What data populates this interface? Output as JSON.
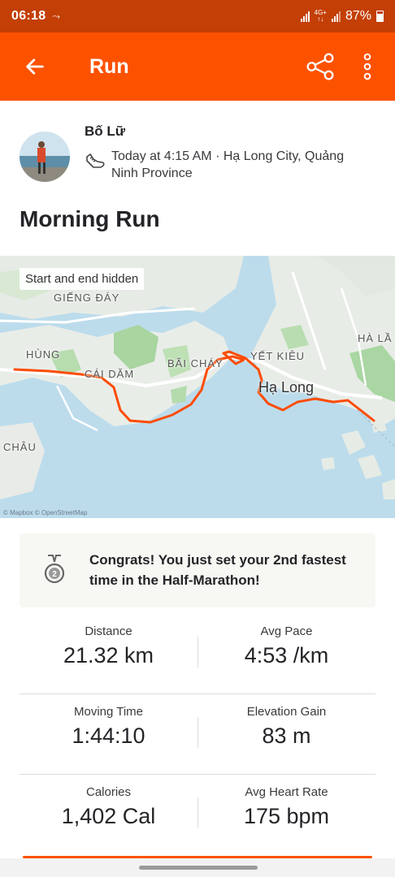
{
  "status_bar": {
    "time": "06:18",
    "notification_icon": "missed-call-icon",
    "battery": "87%"
  },
  "app_bar": {
    "title": "Run",
    "back_icon": "arrow-left-icon",
    "share_icon": "share-icon",
    "more_icon": "more-vertical-icon"
  },
  "athlete": {
    "name": "Bố Lữ",
    "activity_icon": "running-shoe-icon",
    "meta": "Today at 4:15 AM · Hạ Long City, Quảng Ninh Province"
  },
  "activity": {
    "title": "Morning Run"
  },
  "map": {
    "chip": "Start and end hidden",
    "labels": [
      "GIẾNG ĐÁY",
      "HÙNG",
      "CÁI DĂM",
      "BÃI CHÁY",
      "YẾT KIÊU",
      "HÀ LẦ",
      "CHÂU"
    ],
    "city": "Hạ Long",
    "attribution": "© Mapbox © OpenStreetMap",
    "route_color": "#fc4c02"
  },
  "achievement": {
    "icon": "medal-icon",
    "text": "Congrats! You just set your 2nd fastest time in the Half-Marathon!"
  },
  "stats": [
    {
      "left_label": "Distance",
      "left_value": "21.32 km",
      "right_label": "Avg Pace",
      "right_value": "4:53 /km"
    },
    {
      "left_label": "Moving Time",
      "left_value": "1:44:10",
      "right_label": "Elevation Gain",
      "right_value": "83 m"
    },
    {
      "left_label": "Calories",
      "left_value": "1,402 Cal",
      "right_label": "Avg Heart Rate",
      "right_value": "175 bpm"
    }
  ],
  "colors": {
    "brand": "#fc5200",
    "status_bar": "#c33f06"
  }
}
